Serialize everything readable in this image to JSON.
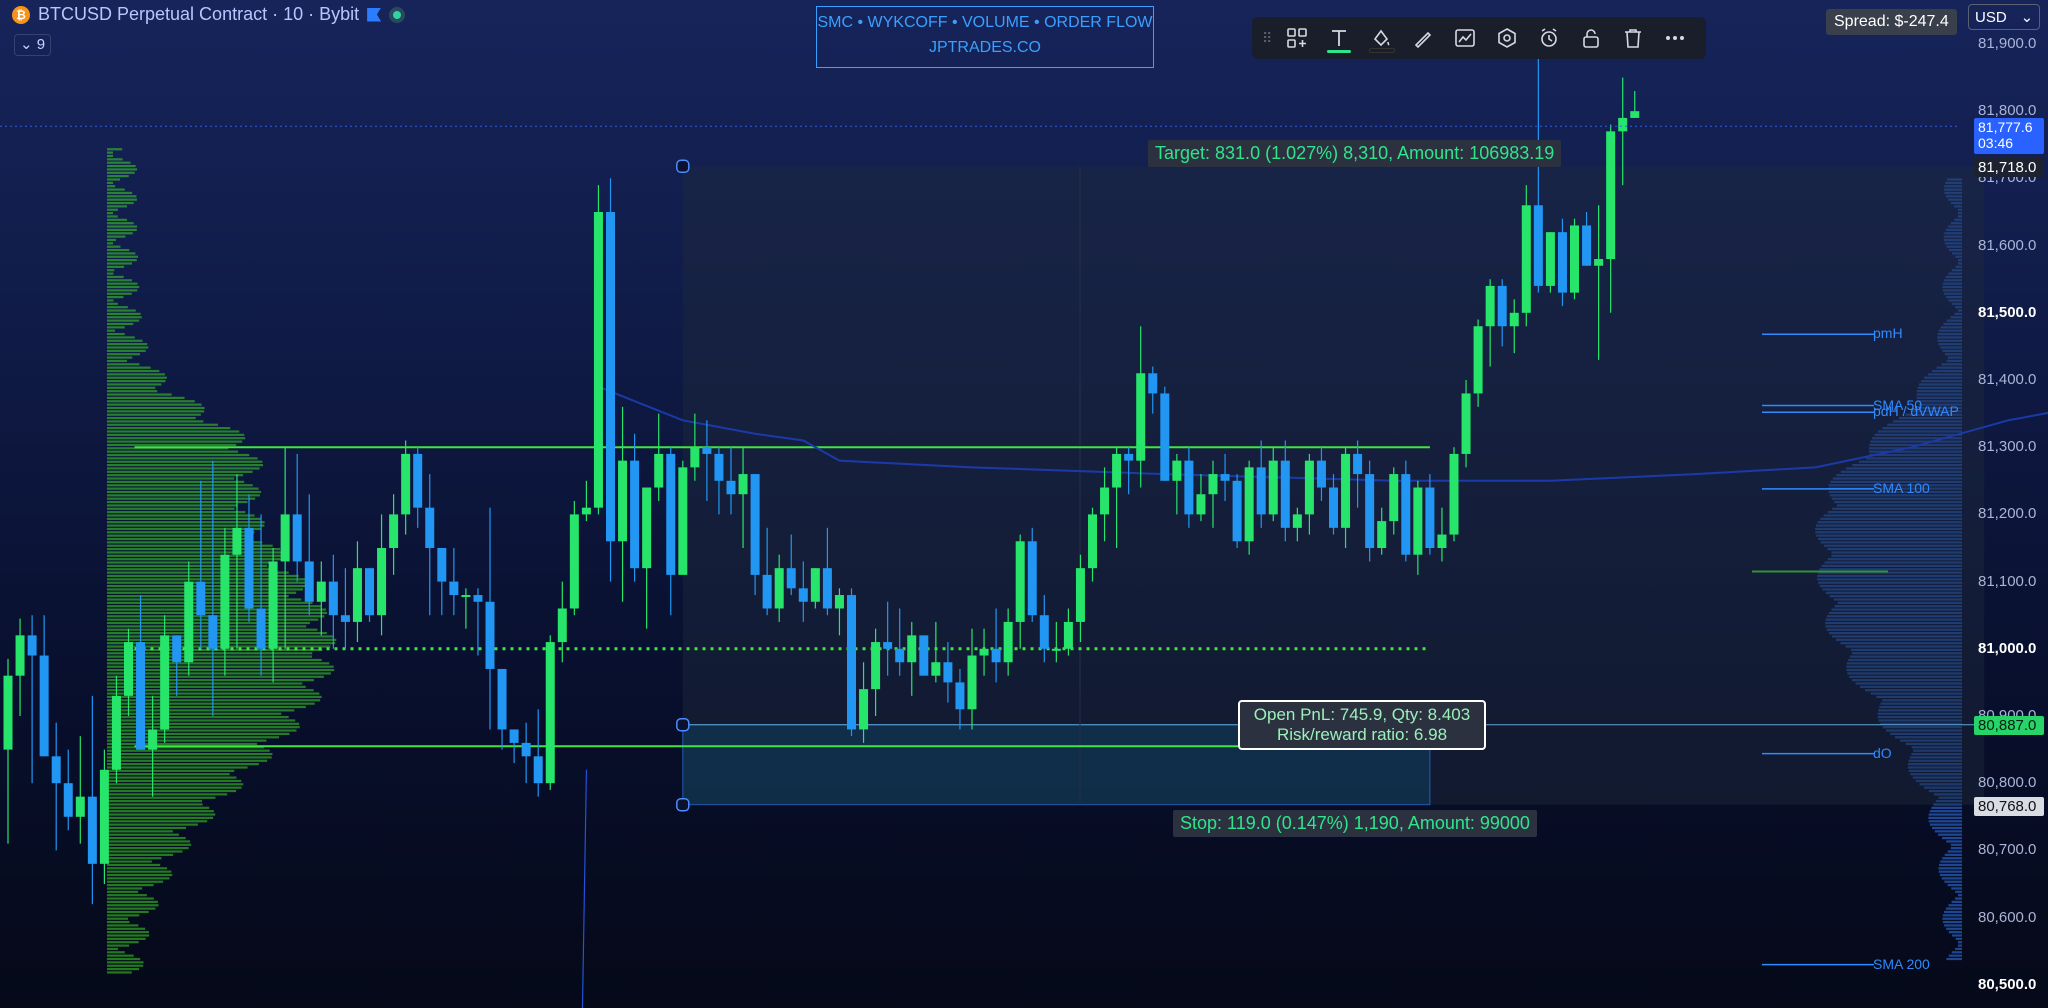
{
  "header": {
    "symbol_title": "BTCUSD Perpetual Contract · 10 · Bybit",
    "btc_logo": "₿",
    "indicators_count": "9"
  },
  "banner": {
    "line1": "SMC • WYKCOFF • VOLUME • ORDER FLOW",
    "line2": "JPTRADES.CO"
  },
  "toolbar": [
    "drag-handle-icon",
    "templates-icon",
    "text-icon",
    "fill-color-icon",
    "line-color-icon",
    "chart-settings-icon",
    "object-settings-icon",
    "alert-icon",
    "lock-icon",
    "trash-icon",
    "more-icon"
  ],
  "spread": "Spread: $-247.4",
  "currency": "USD",
  "axis": {
    "ticks": [
      {
        "price": "81,900.0",
        "bold": false
      },
      {
        "price": "81,800.0",
        "bold": false
      },
      {
        "price": "81,700.0",
        "bold": false
      },
      {
        "price": "81,600.0",
        "bold": false
      },
      {
        "price": "81,500.0",
        "bold": true
      },
      {
        "price": "81,400.0",
        "bold": false
      },
      {
        "price": "81,300.0",
        "bold": false
      },
      {
        "price": "81,200.0",
        "bold": false
      },
      {
        "price": "81,100.0",
        "bold": false
      },
      {
        "price": "81,000.0",
        "bold": true
      },
      {
        "price": "80,900.0",
        "bold": false
      },
      {
        "price": "80,800.0",
        "bold": false
      },
      {
        "price": "80,700.0",
        "bold": false
      },
      {
        "price": "80,600.0",
        "bold": false
      },
      {
        "price": "80,500.0",
        "bold": true
      }
    ],
    "current_price": "81,777.6",
    "countdown": "03:46",
    "target_price": "81,718.0",
    "entry_price": "80,887.0",
    "stop_price": "80,768.0"
  },
  "position": {
    "target_label": "Target: 831.0 (1.027%) 8,310, Amount: 106983.19",
    "stop_label": "Stop: 119.0 (0.147%) 1,190, Amount: 99000",
    "pnl_line1": "Open PnL: 745.9, Qty: 8.403",
    "pnl_line2": "Risk/reward ratio: 6.98"
  },
  "levels": [
    {
      "name": "pmH",
      "price": 81468
    },
    {
      "name": "SMA 50",
      "price": 81362
    },
    {
      "name": "pdH / dVWAP",
      "price": 81352
    },
    {
      "name": "SMA 100",
      "price": 81238
    },
    {
      "name": "dO",
      "price": 80844
    },
    {
      "name": "SMA 200",
      "price": 80530
    }
  ],
  "colors": {
    "up": "#27e56a",
    "down": "#2196f3",
    "vwap": "#1b3aa8",
    "level": "#2f8aff",
    "profile_left": "#3ed624",
    "profile_right": "#2f6fe0"
  },
  "chart_data": {
    "type": "candlestick",
    "instrument": "BTCUSD Perpetual Contract",
    "timeframe": "10",
    "ylim": [
      80490,
      81950
    ],
    "candles": [
      [
        80850,
        80985,
        80710,
        80960
      ],
      [
        80960,
        81045,
        80900,
        81020
      ],
      [
        81020,
        81050,
        80800,
        80990
      ],
      [
        80990,
        81050,
        80840,
        80840
      ],
      [
        80840,
        80890,
        80700,
        80800
      ],
      [
        80800,
        80850,
        80730,
        80750
      ],
      [
        80750,
        80870,
        80710,
        80780
      ],
      [
        80780,
        80930,
        80620,
        80680
      ],
      [
        80680,
        80850,
        80650,
        80820
      ],
      [
        80820,
        80960,
        80800,
        80930
      ],
      [
        80930,
        81030,
        80900,
        81010
      ],
      [
        81010,
        81080,
        80850,
        80850
      ],
      [
        80850,
        80930,
        80780,
        80880
      ],
      [
        80880,
        81050,
        80860,
        81020
      ],
      [
        81020,
        81020,
        80930,
        80980
      ],
      [
        80980,
        81130,
        80960,
        81100
      ],
      [
        81100,
        81250,
        81000,
        81050
      ],
      [
        81050,
        81280,
        80900,
        81000
      ],
      [
        81000,
        81180,
        80960,
        81140
      ],
      [
        81140,
        81260,
        81000,
        81180
      ],
      [
        81180,
        81230,
        81040,
        81060
      ],
      [
        81060,
        81200,
        80960,
        81000
      ],
      [
        81000,
        81150,
        80950,
        81130
      ],
      [
        81130,
        81300,
        81000,
        81200
      ],
      [
        81200,
        81290,
        81100,
        81130
      ],
      [
        81130,
        81230,
        81050,
        81070
      ],
      [
        81070,
        81130,
        81020,
        81100
      ],
      [
        81100,
        81140,
        81000,
        81050
      ],
      [
        81050,
        81120,
        81000,
        81040
      ],
      [
        81040,
        81160,
        81010,
        81120
      ],
      [
        81120,
        81120,
        81040,
        81050
      ],
      [
        81050,
        81200,
        81020,
        81150
      ],
      [
        81150,
        81230,
        81110,
        81200
      ],
      [
        81200,
        81310,
        81170,
        81290
      ],
      [
        81290,
        81300,
        81180,
        81210
      ],
      [
        81210,
        81260,
        81050,
        81150
      ],
      [
        81150,
        81150,
        81050,
        81100
      ],
      [
        81100,
        81150,
        81050,
        81080
      ],
      [
        81080,
        81090,
        81030,
        81080
      ],
      [
        81080,
        81090,
        80990,
        81070
      ],
      [
        81070,
        81210,
        80880,
        80970
      ],
      [
        80970,
        80970,
        80850,
        80880
      ],
      [
        80880,
        80880,
        80830,
        80860
      ],
      [
        80860,
        80890,
        80800,
        80840
      ],
      [
        80840,
        80910,
        80780,
        80800
      ],
      [
        80800,
        81020,
        80790,
        81010
      ],
      [
        81010,
        81100,
        80980,
        81060
      ],
      [
        81060,
        81220,
        81050,
        81200
      ],
      [
        81200,
        81250,
        81190,
        81210
      ],
      [
        81210,
        81690,
        81200,
        81650
      ],
      [
        81650,
        81700,
        81100,
        81160
      ],
      [
        81160,
        81360,
        81070,
        81280
      ],
      [
        81280,
        81320,
        81100,
        81120
      ],
      [
        81120,
        81240,
        81030,
        81240
      ],
      [
        81240,
        81350,
        81220,
        81290
      ],
      [
        81290,
        81300,
        81050,
        81110
      ],
      [
        81110,
        81280,
        81200,
        81270
      ],
      [
        81270,
        81350,
        81250,
        81300
      ],
      [
        81300,
        81340,
        81220,
        81290
      ],
      [
        81290,
        81300,
        81200,
        81250
      ],
      [
        81250,
        81300,
        81200,
        81230
      ],
      [
        81230,
        81300,
        81150,
        81260
      ],
      [
        81260,
        81260,
        81080,
        81110
      ],
      [
        81110,
        81180,
        81050,
        81060
      ],
      [
        81060,
        81140,
        81040,
        81120
      ],
      [
        81120,
        81170,
        81080,
        81090
      ],
      [
        81090,
        81130,
        81040,
        81070
      ],
      [
        81070,
        81120,
        81060,
        81120
      ],
      [
        81120,
        81180,
        81050,
        81060
      ],
      [
        81060,
        81090,
        81020,
        81080
      ],
      [
        81080,
        81090,
        80870,
        80880
      ],
      [
        80880,
        80980,
        80860,
        80940
      ],
      [
        80940,
        81030,
        80900,
        81010
      ],
      [
        81010,
        81070,
        80960,
        81000
      ],
      [
        81000,
        81060,
        80960,
        80980
      ],
      [
        80980,
        81040,
        80930,
        81020
      ],
      [
        81020,
        81020,
        80960,
        80960
      ],
      [
        80960,
        81040,
        80950,
        80980
      ],
      [
        80980,
        81010,
        80920,
        80950
      ],
      [
        80950,
        80970,
        80880,
        80910
      ],
      [
        80910,
        81030,
        80880,
        80990
      ],
      [
        80990,
        81030,
        80960,
        81000
      ],
      [
        81000,
        81060,
        80950,
        80980
      ],
      [
        80980,
        81060,
        80960,
        81040
      ],
      [
        81040,
        81170,
        81000,
        81160
      ],
      [
        81160,
        81180,
        81040,
        81050
      ],
      [
        81050,
        81080,
        80980,
        81000
      ],
      [
        81000,
        81040,
        80980,
        81000
      ],
      [
        81000,
        81060,
        80990,
        81040
      ],
      [
        81040,
        81140,
        81010,
        81120
      ],
      [
        81120,
        81210,
        81100,
        81200
      ],
      [
        81200,
        81270,
        81160,
        81240
      ],
      [
        81240,
        81300,
        81150,
        81290
      ],
      [
        81290,
        81300,
        81230,
        81280
      ],
      [
        81280,
        81480,
        81240,
        81410
      ],
      [
        81410,
        81420,
        81350,
        81380
      ],
      [
        81380,
        81390,
        81250,
        81250
      ],
      [
        81250,
        81290,
        81200,
        81280
      ],
      [
        81280,
        81300,
        81180,
        81200
      ],
      [
        81200,
        81260,
        81190,
        81230
      ],
      [
        81230,
        81280,
        81180,
        81260
      ],
      [
        81260,
        81290,
        81220,
        81250
      ],
      [
        81250,
        81260,
        81150,
        81160
      ],
      [
        81160,
        81280,
        81140,
        81270
      ],
      [
        81270,
        81310,
        81180,
        81200
      ],
      [
        81200,
        81300,
        81190,
        81280
      ],
      [
        81280,
        81310,
        81160,
        81180
      ],
      [
        81180,
        81210,
        81160,
        81200
      ],
      [
        81200,
        81290,
        81170,
        81280
      ],
      [
        81280,
        81300,
        81220,
        81240
      ],
      [
        81240,
        81260,
        81170,
        81180
      ],
      [
        81180,
        81300,
        81150,
        81290
      ],
      [
        81290,
        81310,
        81210,
        81260
      ],
      [
        81260,
        81280,
        81130,
        81150
      ],
      [
        81150,
        81210,
        81140,
        81190
      ],
      [
        81190,
        81270,
        81170,
        81260
      ],
      [
        81260,
        81280,
        81130,
        81140
      ],
      [
        81140,
        81250,
        81110,
        81240
      ],
      [
        81240,
        81260,
        81140,
        81150
      ],
      [
        81150,
        81210,
        81130,
        81170
      ],
      [
        81170,
        81300,
        81160,
        81290
      ],
      [
        81290,
        81400,
        81270,
        81380
      ],
      [
        81380,
        81490,
        81360,
        81480
      ],
      [
        81480,
        81550,
        81420,
        81540
      ],
      [
        81540,
        81550,
        81450,
        81480
      ],
      [
        81480,
        81520,
        81440,
        81500
      ],
      [
        81500,
        81690,
        81480,
        81660
      ],
      [
        81660,
        81910,
        81530,
        81540
      ],
      [
        81540,
        81620,
        81530,
        81620
      ],
      [
        81620,
        81640,
        81510,
        81530
      ],
      [
        81530,
        81640,
        81520,
        81630
      ],
      [
        81630,
        81650,
        81570,
        81570
      ],
      [
        81570,
        81660,
        81430,
        81580
      ],
      [
        81580,
        81780,
        81500,
        81770
      ],
      [
        81770,
        81850,
        81690,
        81790
      ],
      [
        81790,
        81830,
        81790,
        81800
      ]
    ],
    "vwap": [
      [
        49,
        81390
      ],
      [
        56,
        81340
      ],
      [
        62,
        81320
      ],
      [
        66,
        81310
      ],
      [
        69,
        81280
      ],
      [
        80,
        81270
      ],
      [
        96,
        81260
      ],
      [
        115,
        81250
      ],
      [
        128,
        81250
      ],
      [
        140,
        81260
      ],
      [
        150,
        81270
      ],
      [
        158,
        81300
      ],
      [
        166,
        81340
      ],
      [
        172,
        81360
      ]
    ],
    "pos_left": 56,
    "pos_entry_right": 118,
    "pos_right": 164,
    "hlines": [
      {
        "price": 81300,
        "color": "#3ee63e",
        "x0": 10.5,
        "x1": 118,
        "style": "solid"
      },
      {
        "price": 80855,
        "color": "#3ee63e",
        "x0": 10.5,
        "x1": 118,
        "style": "solid"
      },
      {
        "price": 81000,
        "color": "#3ee63e",
        "x0": 10.5,
        "x1": 118,
        "style": "dotted"
      }
    ]
  }
}
